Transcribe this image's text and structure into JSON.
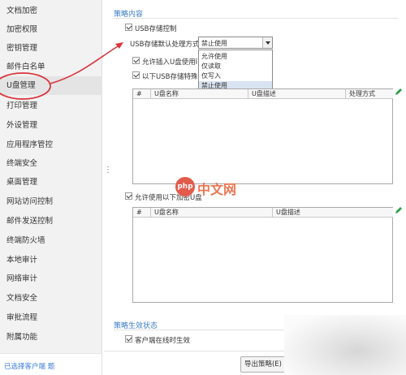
{
  "sidebar": {
    "items": [
      {
        "label": "文档加密"
      },
      {
        "label": "加密权限"
      },
      {
        "label": "密钥管理"
      },
      {
        "label": "邮件白名单"
      },
      {
        "label": "U盘管理"
      },
      {
        "label": "打印管理"
      },
      {
        "label": "外设管理"
      },
      {
        "label": "应用程序管控"
      },
      {
        "label": "终端安全"
      },
      {
        "label": "桌面管理"
      },
      {
        "label": "网站访问控制"
      },
      {
        "label": "邮件发送控制"
      },
      {
        "label": "终端防火墙"
      },
      {
        "label": "本地审计"
      },
      {
        "label": "网络审计"
      },
      {
        "label": "文档安全"
      },
      {
        "label": "审批流程"
      },
      {
        "label": "附属功能"
      }
    ],
    "active_index": 4,
    "footer": "已选择客户端 题"
  },
  "policy": {
    "section_title": "策略内容",
    "usb_control_label": "USB存储控制",
    "default_handling_label": "USB存储默认处理方式",
    "default_handling_value": "禁止使用",
    "options": [
      "允许使用",
      "仅读取",
      "仅写入",
      "禁止使用"
    ],
    "highlighted_option_index": 3,
    "allow_insert_label": "允许插入U盘使用时",
    "following_usb_label": "以下USB存储特殊处",
    "table1_headers": [
      "#",
      "U盘名称",
      "U盘描述",
      "处理方式"
    ],
    "allow_following_label": "允许使用以下加密U盘",
    "table2_headers": [
      "#",
      "U盘名称",
      "U盘描述"
    ]
  },
  "status": {
    "section_title": "策略生效状态",
    "client_offline_label": "客户端在线时生效"
  },
  "buttons": {
    "export": "导出策略(E)"
  },
  "watermark": {
    "logo": "php",
    "text": "中文网"
  },
  "colors": {
    "accent_blue": "#3c7dc4",
    "annotation_red": "#d9363e",
    "edit_green": "#2e9e4a"
  }
}
